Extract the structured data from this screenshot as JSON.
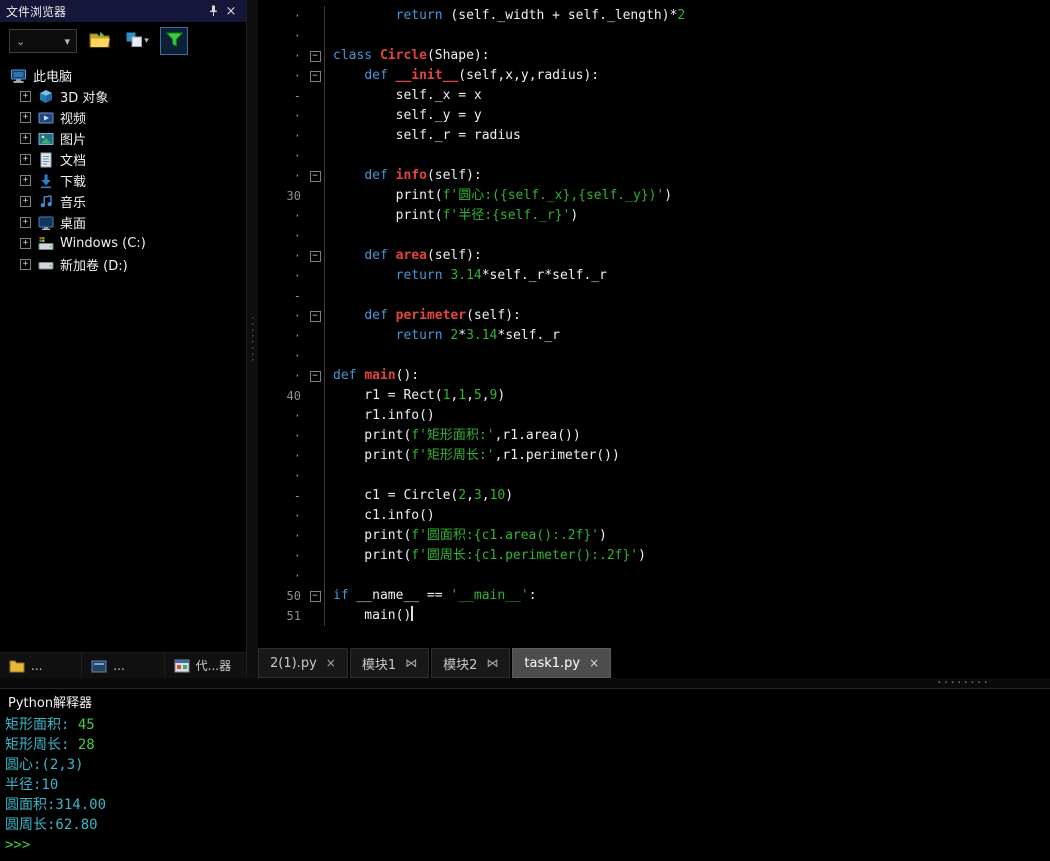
{
  "colors": {
    "keyword": "#4a96d8",
    "def_name": "#e2453f",
    "string": "#33b333",
    "number": "#33b333",
    "console_info": "#38b7c8",
    "console_ok": "#41cf41",
    "panel_title_bg": "#16163a",
    "active_tab_bg": "#4d4d4d",
    "filter_selected_border": "#3c6ea8"
  },
  "icons": {
    "close": "×",
    "pin": "pin",
    "expand_plus": "+",
    "fold_minus": "−",
    "chevron_down": "⌄",
    "menu_arrow": "▾",
    "grip_dots_h": "········",
    "grip_dots_v": "········"
  },
  "file_browser": {
    "title": "文件浏览器",
    "toolbar": [
      {
        "name": "view-dropdown",
        "type": "combo"
      },
      {
        "name": "open-folder-icon",
        "type": "button"
      },
      {
        "name": "layers-icon",
        "type": "button",
        "menu": true
      },
      {
        "name": "filter-icon",
        "type": "button",
        "selected": true
      }
    ],
    "tree": [
      {
        "label": "此电脑",
        "icon": "computer-icon",
        "root": true,
        "expandable": false
      },
      {
        "label": "3D 对象",
        "icon": "cube-3d-icon",
        "expandable": true
      },
      {
        "label": "视频",
        "icon": "video-icon",
        "expandable": true
      },
      {
        "label": "图片",
        "icon": "picture-icon",
        "expandable": true
      },
      {
        "label": "文档",
        "icon": "document-icon",
        "expandable": true
      },
      {
        "label": "下载",
        "icon": "download-icon",
        "expandable": true
      },
      {
        "label": "音乐",
        "icon": "music-icon",
        "expandable": true
      },
      {
        "label": "桌面",
        "icon": "desktop-icon",
        "expandable": true
      },
      {
        "label": "Windows (C:)",
        "icon": "windows-drive-icon",
        "expandable": true
      },
      {
        "label": "新加卷 (D:)",
        "icon": "drive-icon",
        "expandable": true
      }
    ],
    "dock_tabs": [
      {
        "label": "...",
        "icon": "files-dock-icon"
      },
      {
        "label": "...",
        "icon": "modules-dock-icon"
      },
      {
        "label": "代...器",
        "icon": "code-browser-dock-icon"
      }
    ]
  },
  "editor": {
    "tabs": [
      {
        "label": "2(1).py",
        "close": "×",
        "active": false
      },
      {
        "label": "模块1",
        "close": "⋈",
        "active": false
      },
      {
        "label": "模块2",
        "close": "⋈",
        "active": false
      },
      {
        "label": "task1.py",
        "close": "×",
        "active": true
      }
    ],
    "lines": [
      {
        "g": "·",
        "fold": "",
        "tokens": [
          [
            "pl",
            "        "
          ],
          [
            "kw",
            "return"
          ],
          [
            "pl",
            " (self._width + self._length)*"
          ],
          [
            "nu",
            "2"
          ]
        ]
      },
      {
        "g": "·",
        "fold": "",
        "tokens": []
      },
      {
        "g": "·",
        "fold": "box",
        "tokens": [
          [
            "kw",
            "class"
          ],
          [
            "pl",
            " "
          ],
          [
            "df",
            "Circle"
          ],
          [
            "pl",
            "(Shape):"
          ]
        ]
      },
      {
        "g": "·",
        "fold": "box",
        "tokens": [
          [
            "pl",
            "    "
          ],
          [
            "kw",
            "def"
          ],
          [
            "pl",
            " "
          ],
          [
            "df",
            "__init__"
          ],
          [
            "pl",
            "(self,x,y,radius):"
          ]
        ]
      },
      {
        "g": "-",
        "fold": "",
        "tokens": [
          [
            "pl",
            "        self._x = x"
          ]
        ]
      },
      {
        "g": "·",
        "fold": "",
        "tokens": [
          [
            "pl",
            "        self._y = y"
          ]
        ]
      },
      {
        "g": "·",
        "fold": "",
        "tokens": [
          [
            "pl",
            "        self._r = radius"
          ]
        ]
      },
      {
        "g": "·",
        "fold": "",
        "tokens": []
      },
      {
        "g": "·",
        "fold": "box",
        "tokens": [
          [
            "pl",
            "    "
          ],
          [
            "kw",
            "def"
          ],
          [
            "pl",
            " "
          ],
          [
            "df",
            "info"
          ],
          [
            "pl",
            "(self):"
          ]
        ]
      },
      {
        "g": "30",
        "fold": "",
        "tokens": [
          [
            "pl",
            "        print("
          ],
          [
            "st",
            "f'圆心:({self._x},{self._y})'"
          ],
          [
            "pl",
            ")"
          ]
        ]
      },
      {
        "g": "·",
        "fold": "",
        "tokens": [
          [
            "pl",
            "        print("
          ],
          [
            "st",
            "f'半径:{self._r}'"
          ],
          [
            "pl",
            ")"
          ]
        ]
      },
      {
        "g": "·",
        "fold": "",
        "tokens": []
      },
      {
        "g": "·",
        "fold": "box",
        "tokens": [
          [
            "pl",
            "    "
          ],
          [
            "kw",
            "def"
          ],
          [
            "pl",
            " "
          ],
          [
            "df",
            "area"
          ],
          [
            "pl",
            "(self):"
          ]
        ]
      },
      {
        "g": "·",
        "fold": "",
        "tokens": [
          [
            "pl",
            "        "
          ],
          [
            "kw",
            "return"
          ],
          [
            "pl",
            " "
          ],
          [
            "nu",
            "3.14"
          ],
          [
            "pl",
            "*self._r*self._r"
          ]
        ]
      },
      {
        "g": "-",
        "fold": "",
        "tokens": []
      },
      {
        "g": "·",
        "fold": "box",
        "tokens": [
          [
            "pl",
            "    "
          ],
          [
            "kw",
            "def"
          ],
          [
            "pl",
            " "
          ],
          [
            "df",
            "perimeter"
          ],
          [
            "pl",
            "(self):"
          ]
        ]
      },
      {
        "g": "·",
        "fold": "",
        "tokens": [
          [
            "pl",
            "        "
          ],
          [
            "kw",
            "return"
          ],
          [
            "pl",
            " "
          ],
          [
            "nu",
            "2"
          ],
          [
            "pl",
            "*"
          ],
          [
            "nu",
            "3.14"
          ],
          [
            "pl",
            "*self._r"
          ]
        ]
      },
      {
        "g": "·",
        "fold": "",
        "tokens": []
      },
      {
        "g": "·",
        "fold": "box",
        "tokens": [
          [
            "kw",
            "def"
          ],
          [
            "pl",
            " "
          ],
          [
            "df",
            "main"
          ],
          [
            "pl",
            "():"
          ]
        ]
      },
      {
        "g": "40",
        "fold": "",
        "tokens": [
          [
            "pl",
            "    r1 = Rect("
          ],
          [
            "nu",
            "1"
          ],
          [
            "pl",
            ","
          ],
          [
            "nu",
            "1"
          ],
          [
            "pl",
            ","
          ],
          [
            "nu",
            "5"
          ],
          [
            "pl",
            ","
          ],
          [
            "nu",
            "9"
          ],
          [
            "pl",
            ")"
          ]
        ]
      },
      {
        "g": "·",
        "fold": "",
        "tokens": [
          [
            "pl",
            "    r1.info()"
          ]
        ]
      },
      {
        "g": "·",
        "fold": "",
        "tokens": [
          [
            "pl",
            "    print("
          ],
          [
            "st",
            "f'矩形面积:'"
          ],
          [
            "pl",
            ",r1.area())"
          ]
        ]
      },
      {
        "g": "·",
        "fold": "",
        "tokens": [
          [
            "pl",
            "    print("
          ],
          [
            "st",
            "f'矩形周长:'"
          ],
          [
            "pl",
            ",r1.perimeter())"
          ]
        ]
      },
      {
        "g": "·",
        "fold": "",
        "tokens": []
      },
      {
        "g": "-",
        "fold": "",
        "tokens": [
          [
            "pl",
            "    c1 = Circle("
          ],
          [
            "nu",
            "2"
          ],
          [
            "pl",
            ","
          ],
          [
            "nu",
            "3"
          ],
          [
            "pl",
            ","
          ],
          [
            "nu",
            "10"
          ],
          [
            "pl",
            ")"
          ]
        ]
      },
      {
        "g": "·",
        "fold": "",
        "tokens": [
          [
            "pl",
            "    c1.info()"
          ]
        ]
      },
      {
        "g": "·",
        "fold": "",
        "tokens": [
          [
            "pl",
            "    print("
          ],
          [
            "st",
            "f'圆面积:{c1.area():.2f}'"
          ],
          [
            "pl",
            ")"
          ]
        ]
      },
      {
        "g": "·",
        "fold": "",
        "tokens": [
          [
            "pl",
            "    print("
          ],
          [
            "st",
            "f'圆周长:{c1.perimeter():.2f}'"
          ],
          [
            "pl",
            ")"
          ]
        ]
      },
      {
        "g": "·",
        "fold": "",
        "tokens": []
      },
      {
        "g": "50",
        "fold": "box",
        "tokens": [
          [
            "kw",
            "if"
          ],
          [
            "pl",
            " __name__ == "
          ],
          [
            "st",
            "'__main__'"
          ],
          [
            "pl",
            ":"
          ]
        ]
      },
      {
        "g": "51",
        "fold": "",
        "cursor": true,
        "tokens": [
          [
            "pl",
            "    main()"
          ]
        ]
      }
    ]
  },
  "console": {
    "title": "Python解释器",
    "lines": [
      {
        "tokens": [
          [
            "cy",
            "矩形面积:"
          ],
          [
            "gr",
            " 45"
          ]
        ]
      },
      {
        "tokens": [
          [
            "cy",
            "矩形周长:"
          ],
          [
            "gr",
            " 28"
          ]
        ]
      },
      {
        "tokens": [
          [
            "cy",
            "圆心:(2,3)"
          ]
        ]
      },
      {
        "tokens": [
          [
            "cy",
            "半径:10"
          ]
        ]
      },
      {
        "tokens": [
          [
            "cy",
            "圆面积:314.00"
          ]
        ]
      },
      {
        "tokens": [
          [
            "cy",
            "圆周长:62.80"
          ]
        ]
      },
      {
        "tokens": [
          [
            "gr",
            ">>>"
          ]
        ]
      }
    ]
  }
}
